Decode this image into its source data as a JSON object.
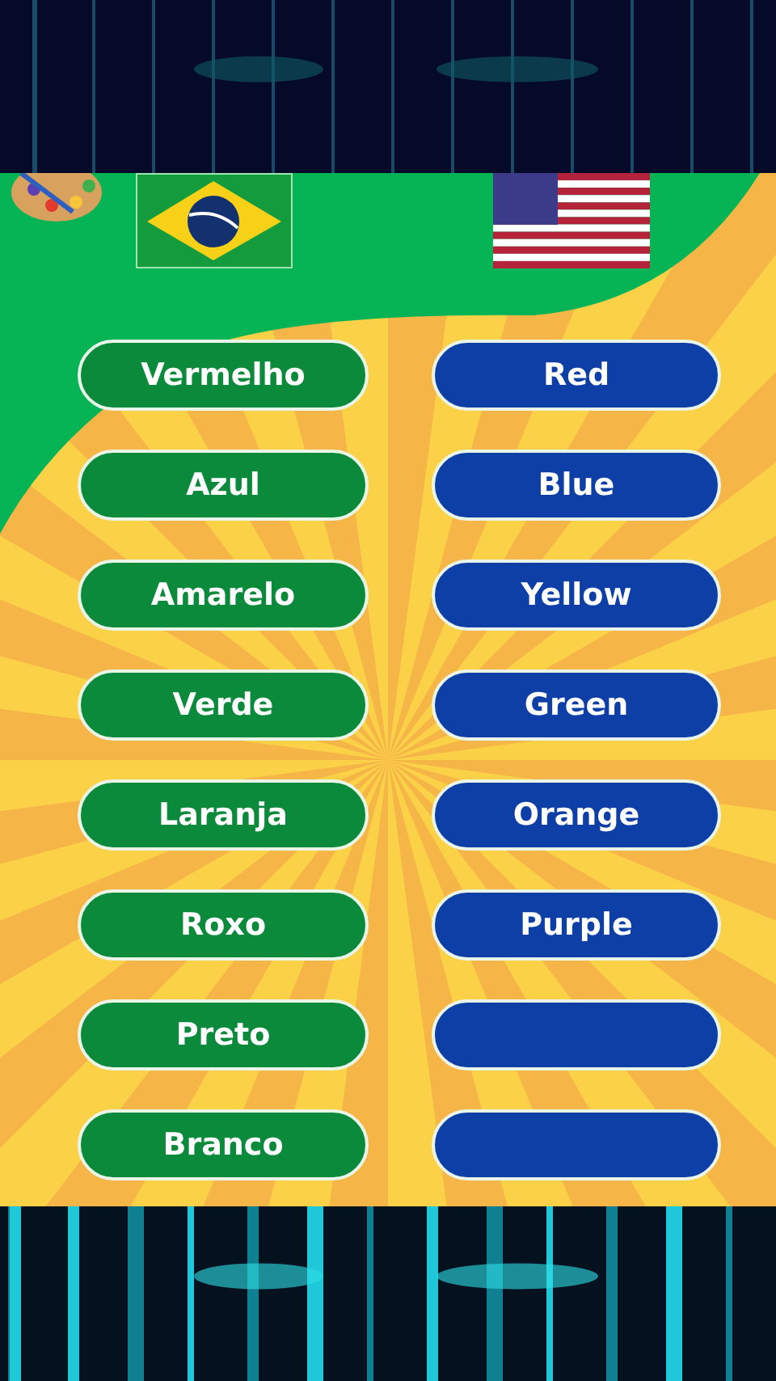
{
  "languages": [
    {
      "kind": "brazil"
    },
    {
      "kind": "usa"
    }
  ],
  "portuguese_words": [
    {
      "label": "Vermelho"
    },
    {
      "label": "Azul"
    },
    {
      "label": "Amarelo"
    },
    {
      "label": "Verde"
    },
    {
      "label": "Laranja"
    },
    {
      "label": "Roxo"
    },
    {
      "label": "Preto"
    },
    {
      "label": "Branco"
    }
  ],
  "english_words": [
    {
      "kind": "word",
      "label": "Red"
    },
    {
      "kind": "word",
      "label": "Blue"
    },
    {
      "kind": "word",
      "label": "Yellow"
    },
    {
      "kind": "word",
      "label": "Green"
    },
    {
      "kind": "word",
      "label": "Orange"
    },
    {
      "kind": "word",
      "label": "Purple"
    },
    {
      "kind": "blank"
    },
    {
      "kind": "blank"
    }
  ]
}
